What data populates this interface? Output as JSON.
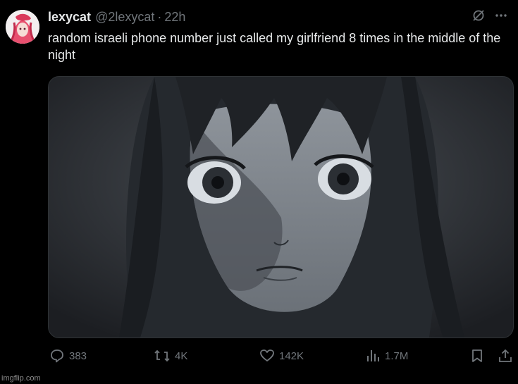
{
  "tweet": {
    "display_name": "lexycat",
    "handle": "@2lexycat",
    "separator": "·",
    "time": "22h",
    "text": "random israeli phone number just called my girlfriend 8 times in the middle of the night",
    "media_alt": "anime girl staring wide-eyed in the dark"
  },
  "actions": {
    "replies": "383",
    "reposts": "4K",
    "likes": "142K",
    "views": "1.7M"
  },
  "icons": {
    "grok": "grok-icon",
    "more": "more-icon",
    "reply": "reply-icon",
    "repost": "repost-icon",
    "like": "like-icon",
    "views": "views-icon",
    "bookmark": "bookmark-icon",
    "share": "share-icon"
  },
  "watermark": "imgflip.com",
  "colors": {
    "background": "#000000",
    "text": "#e7e9ea",
    "muted": "#71767b",
    "border": "#2f3336"
  }
}
